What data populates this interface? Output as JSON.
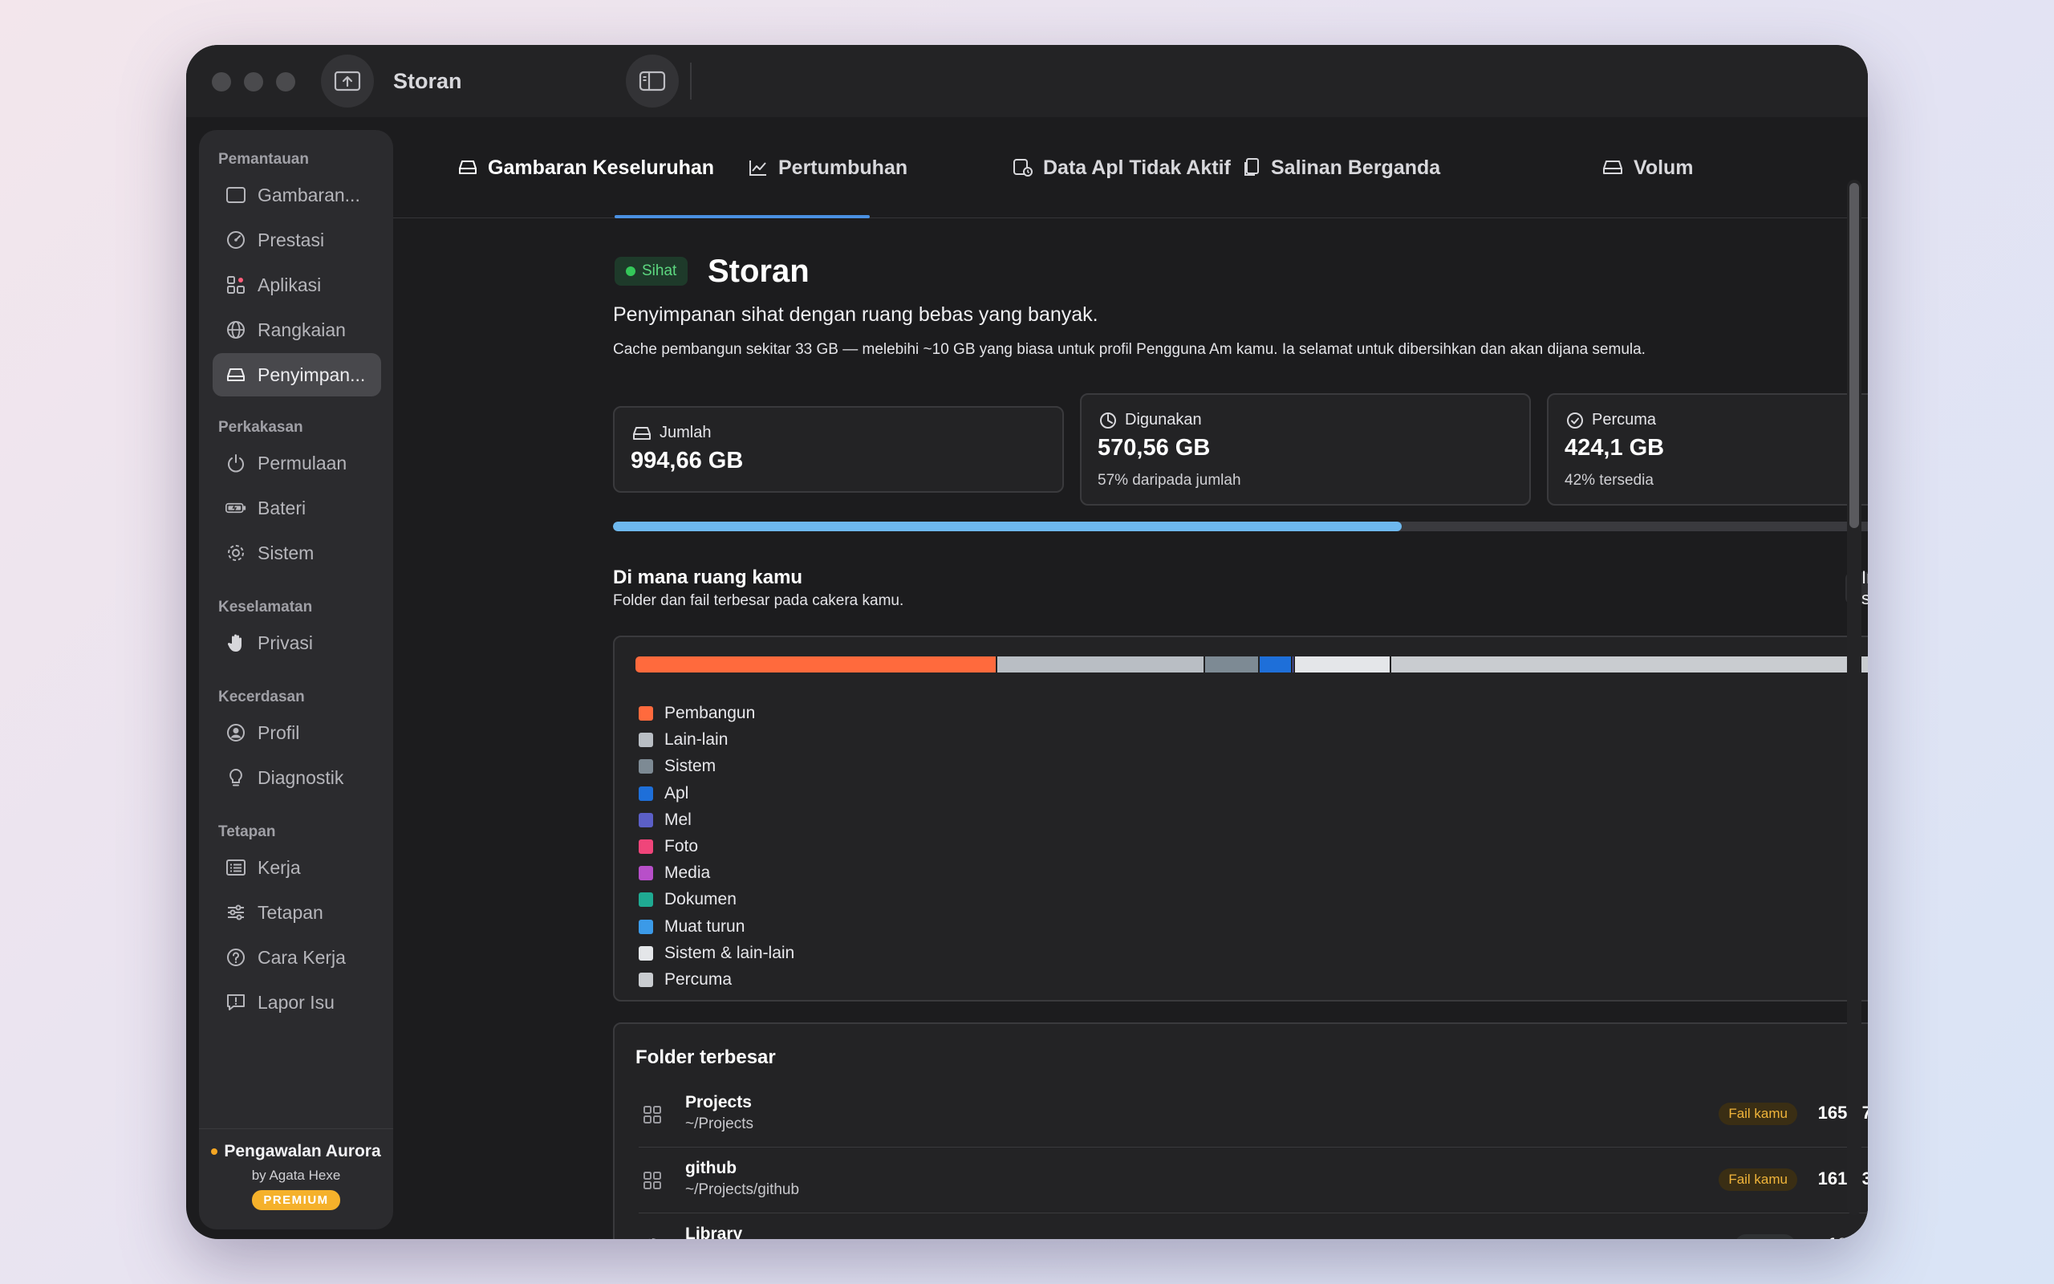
{
  "window": {
    "title": "Storan"
  },
  "sidebar": {
    "sections": [
      {
        "label": "Pemantauan"
      },
      {
        "label": "Perkakasan"
      },
      {
        "label": "Keselamatan"
      },
      {
        "label": "Kecerdasan"
      },
      {
        "label": "Tetapan"
      }
    ],
    "items": [
      {
        "label": "Gambaran...",
        "icon": "overview-icon"
      },
      {
        "label": "Prestasi",
        "icon": "gauge-icon"
      },
      {
        "label": "Aplikasi",
        "icon": "apps-grid-icon"
      },
      {
        "label": "Rangkaian",
        "icon": "globe-icon"
      },
      {
        "label": "Penyimpan...",
        "icon": "drive-icon"
      },
      {
        "label": "Permulaan",
        "icon": "power-icon"
      },
      {
        "label": "Bateri",
        "icon": "battery-icon"
      },
      {
        "label": "Sistem",
        "icon": "gear-icon"
      },
      {
        "label": "Privasi",
        "icon": "hand-icon"
      },
      {
        "label": "Profil",
        "icon": "user-circle-icon"
      },
      {
        "label": "Diagnostik",
        "icon": "lightbulb-icon"
      },
      {
        "label": "Kerja",
        "icon": "list-icon"
      },
      {
        "label": "Tetapan",
        "icon": "sliders-icon"
      },
      {
        "label": "Cara Kerja",
        "icon": "question-icon"
      },
      {
        "label": "Lapor Isu",
        "icon": "feedback-icon"
      }
    ],
    "footer": {
      "name": "Pengawalan Aurora",
      "by": "by Agata Hexe",
      "badge": "PREMIUM"
    }
  },
  "tabs": [
    {
      "label": "Gambaran Keseluruhan",
      "active": true
    },
    {
      "label": "Pertumbuhan"
    },
    {
      "label": "Data Apl Tidak Aktif"
    },
    {
      "label": "Salinan Berganda"
    },
    {
      "label": "Volum"
    }
  ],
  "header": {
    "status": "Sihat",
    "title": "Storan",
    "subtitle": "Penyimpanan sihat dengan ruang bebas yang banyak.",
    "note": "Cache pembangun sekitar 33 GB — melebihi ~10 GB yang biasa untuk profil Pengguna Am kamu. Ia selamat untuk dibersihkan dan akan dijana semula."
  },
  "stats": {
    "total": {
      "label": "Jumlah",
      "value": "994,66 GB"
    },
    "used": {
      "label": "Digunakan",
      "value": "570,56 GB",
      "sub": "57% daripada jumlah"
    },
    "free": {
      "label": "Percuma",
      "value": "424,1 GB",
      "sub": "42% tersedia"
    }
  },
  "usage_fraction": 0.57,
  "breakdown": {
    "title": "Di mana ruang kamu",
    "subtitle": "Folder dan fail terbesar pada cakera kamu.",
    "reset": "Imbas semula",
    "items": [
      {
        "label": "Pembangun",
        "value": "264,73 GB",
        "color": "#ff6a3d",
        "gb": 264.73
      },
      {
        "label": "Lain-lain",
        "value": "151,75 GB",
        "color": "#b9bec4",
        "gb": 151.75
      },
      {
        "label": "Sistem",
        "value": "38,69 GB",
        "color": "#7d8a94",
        "gb": 38.69
      },
      {
        "label": "Apl",
        "value": "23,03 GB",
        "color": "#1e6fd9",
        "gb": 23.03
      },
      {
        "label": "Mel",
        "value": "577 MB",
        "color": "#5b5fc7",
        "gb": 0.577
      },
      {
        "label": "Foto",
        "value": "49,4 MB",
        "color": "#f0457a",
        "gb": 0.0494
      },
      {
        "label": "Media",
        "value": "45,5 MB",
        "color": "#b84fc9",
        "gb": 0.0455
      },
      {
        "label": "Dokumen",
        "value": "34 MB",
        "color": "#1faa92",
        "gb": 0.034
      },
      {
        "label": "Muat turun",
        "value": "0 MB",
        "color": "#3b9ae8",
        "gb": 0
      },
      {
        "label": "Sistem & lain-lain",
        "value": "69,88 GB",
        "color": "#e4e6e9",
        "gb": 69.88
      },
      {
        "label": "Percuma",
        "value": "445,88 GB",
        "color": "#c9ccd0",
        "gb": 445.88
      }
    ]
  },
  "folders": {
    "title": "Folder terbesar",
    "rows": [
      {
        "name": "Projects",
        "path": "~/Projects",
        "tag": "Fail kamu",
        "size": "165,87 GB",
        "icon": "grid-folder-icon"
      },
      {
        "name": "github",
        "path": "~/Projects/github",
        "tag": "Fail kamu",
        "size": "161,63 GB",
        "icon": "grid-folder-icon"
      },
      {
        "name": "Library",
        "path": "~/Library",
        "tag": "Sistem",
        "size": "138,3 GB",
        "icon": "gear-icon"
      }
    ]
  }
}
